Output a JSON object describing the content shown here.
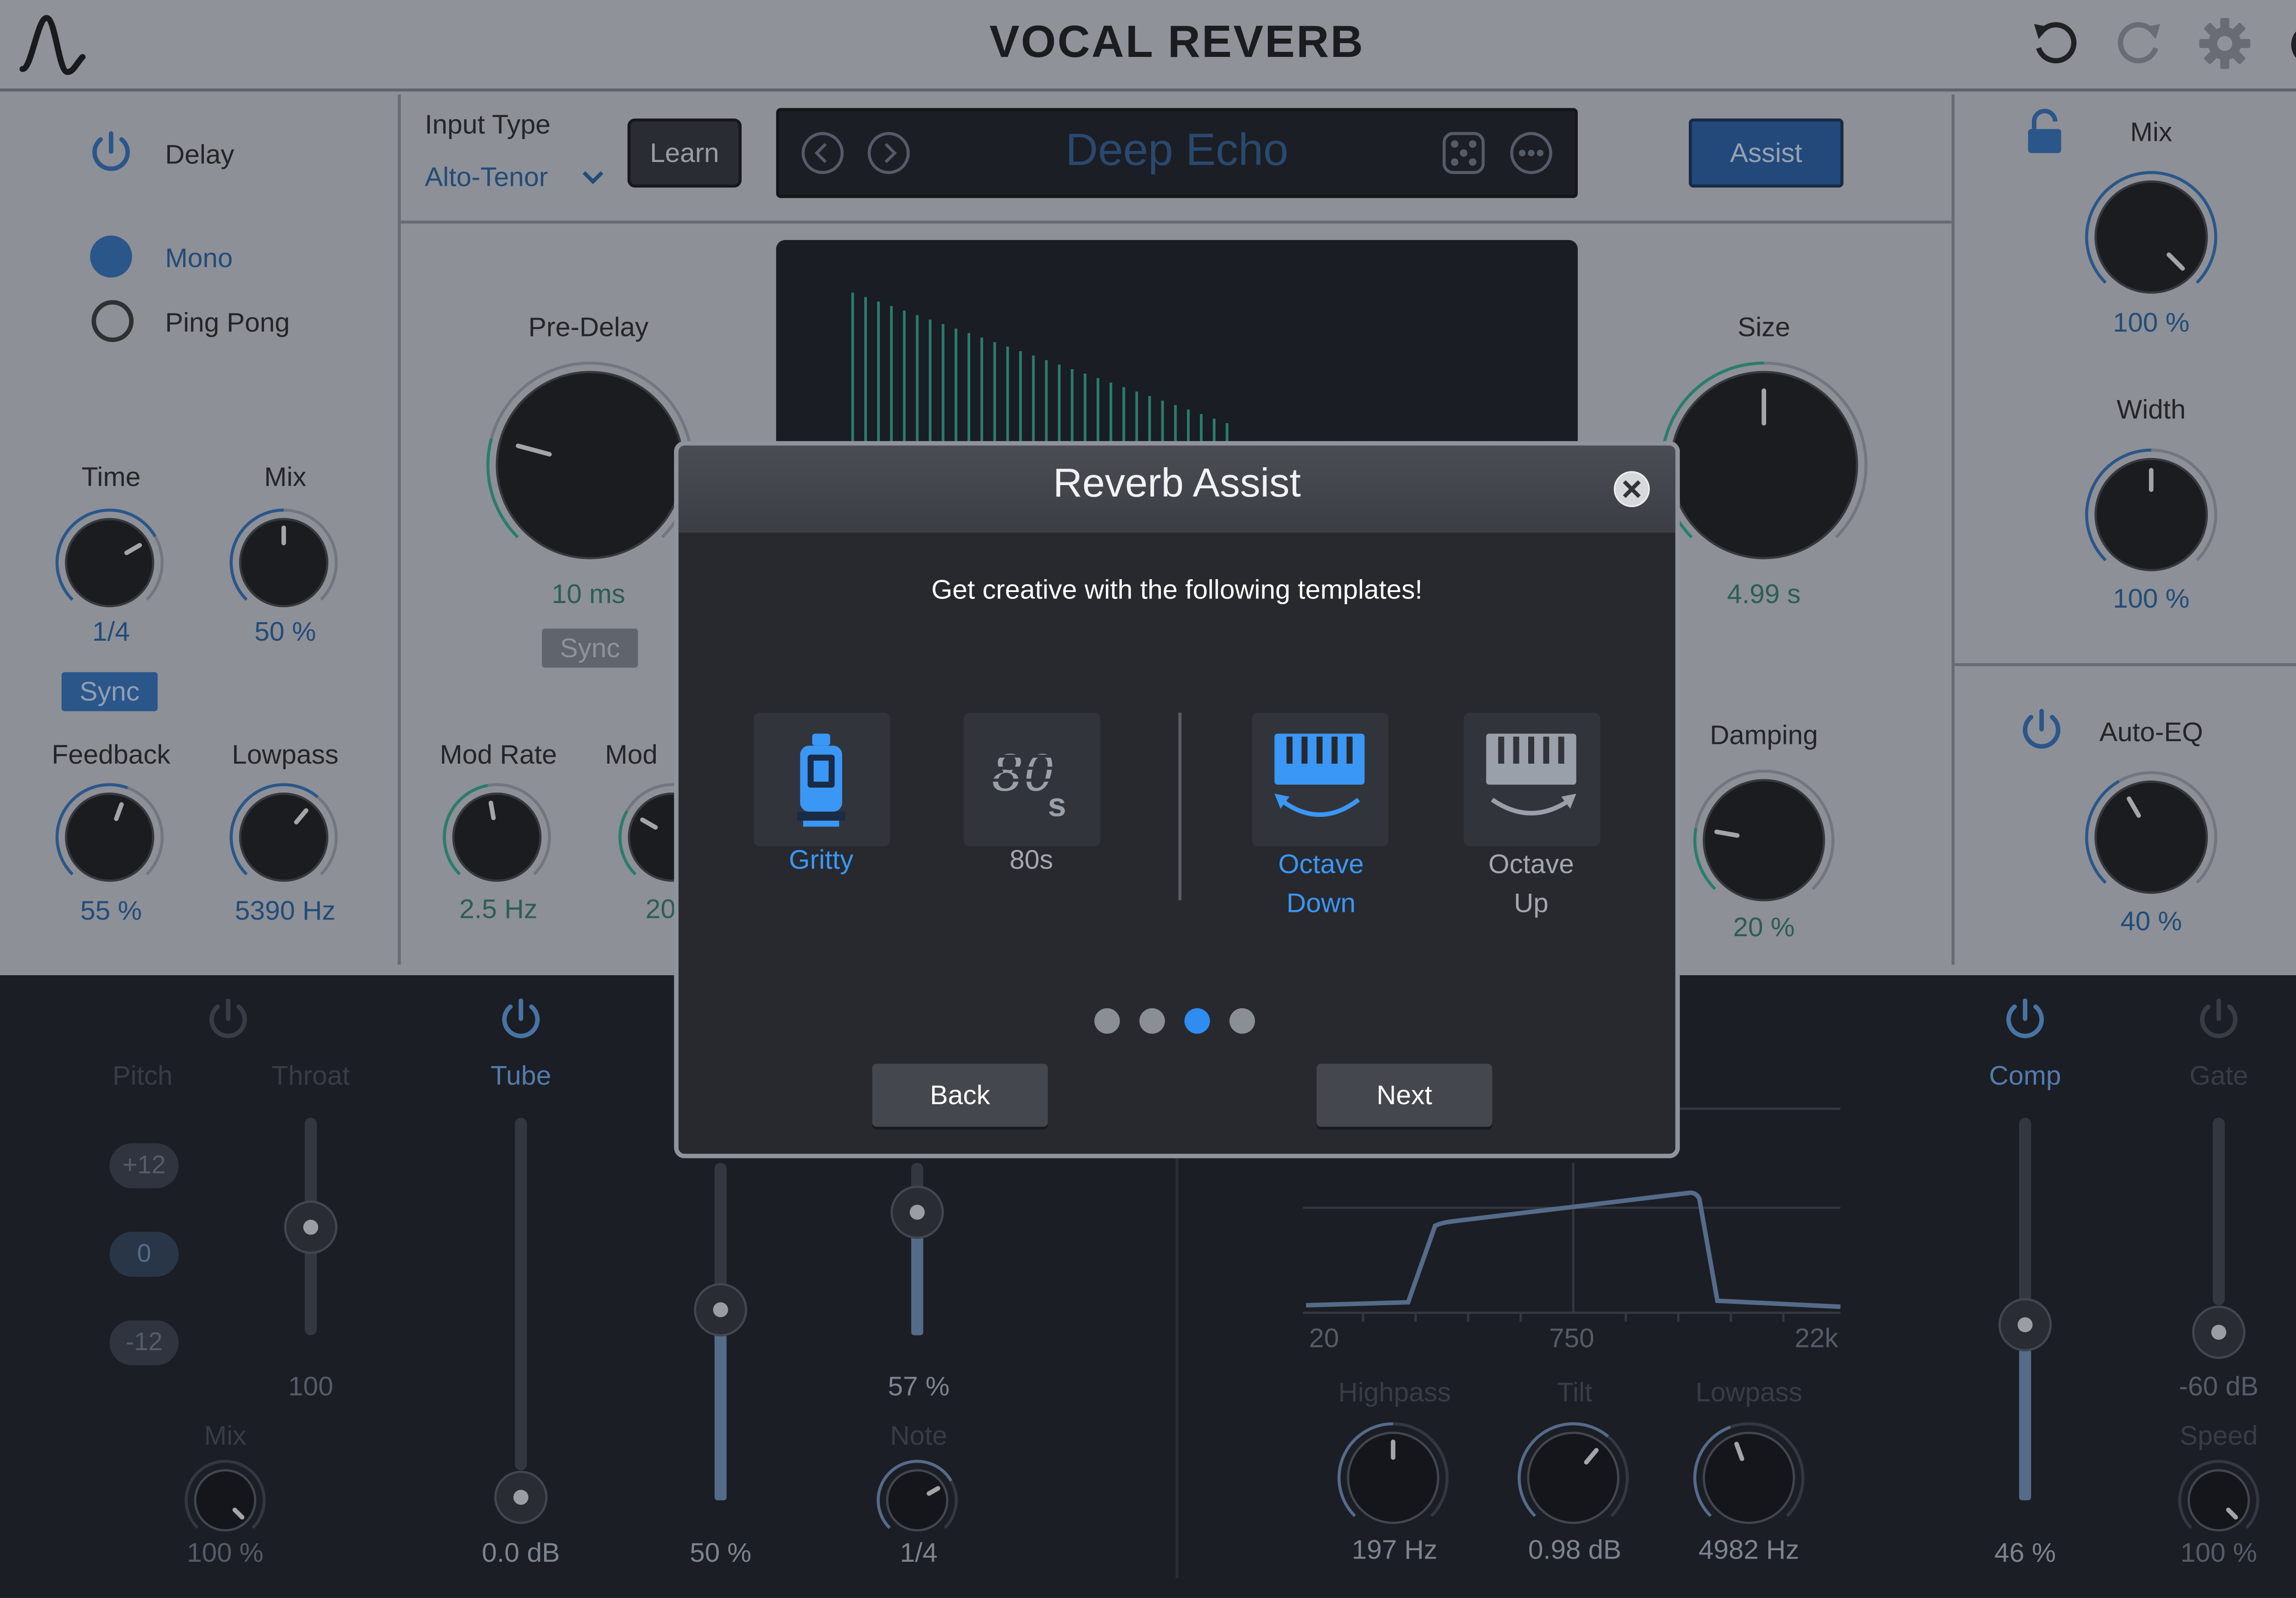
{
  "app": {
    "title": "VOCAL REVERB"
  },
  "delay": {
    "label": "Delay",
    "mode_mono": "Mono",
    "mode_pingpong": "Ping Pong",
    "time_label": "Time",
    "time_value": "1/4",
    "mix_label": "Mix",
    "mix_value": "50 %",
    "sync_label": "Sync",
    "feedback_label": "Feedback",
    "feedback_value": "55 %",
    "lowpass_label": "Lowpass",
    "lowpass_value": "5390 Hz"
  },
  "input": {
    "label": "Input Type",
    "value": "Alto-Tenor",
    "learn_label": "Learn"
  },
  "preset": {
    "name": "Deep Echo",
    "assist_label": "Assist"
  },
  "reverb": {
    "predelay_label": "Pre-Delay",
    "predelay_value": "10 ms",
    "sync_label": "Sync",
    "size_label": "Size",
    "size_value": "4.99 s",
    "modrate_label": "Mod Rate",
    "modrate_value": "2.5 Hz",
    "mod_label": "Mod",
    "mod_value": "20",
    "damping_label": "Damping",
    "damping_value": "20 %"
  },
  "output": {
    "mix_label": "Mix",
    "mix_value": "100 %",
    "width_label": "Width",
    "width_value": "100 %",
    "autoeq_label": "Auto-EQ",
    "autoeq_value": "40 %"
  },
  "strip": {
    "pitch_label": "Pitch",
    "pitch_options": [
      "+12",
      "0",
      "-12"
    ],
    "throat_label": "Throat",
    "throat_value": "100",
    "pitch_mix_label": "Mix",
    "pitch_mix_value": "100 %",
    "tube_label": "Tube",
    "tube_value": "0.0 dB",
    "tube_drive_value": "50 %",
    "note_slider_value": "57 %",
    "note_label": "Note",
    "note_value": "1/4",
    "eq_axis": [
      "20",
      "750",
      "22k"
    ],
    "highpass_label": "Highpass",
    "highpass_value": "197 Hz",
    "tilt_label": "Tilt",
    "tilt_value": "0.98 dB",
    "lowpass_label": "Lowpass",
    "lowpass_value": "4982 Hz",
    "comp_label": "Comp",
    "comp_value": "46 %",
    "gate_label": "Gate",
    "gate_value": "-60 dB",
    "speed_label": "Speed",
    "speed_value": "100 %"
  },
  "modal": {
    "title": "Reverb Assist",
    "subtitle": "Get creative with the following templates!",
    "templates": [
      {
        "label": "Gritty",
        "selected": true,
        "icon": "tube-icon"
      },
      {
        "label": "80s",
        "selected": false,
        "icon": "80s-icon"
      },
      {
        "label": "Octave\nDown",
        "selected": true,
        "icon": "keyboard-down-icon"
      },
      {
        "label": "Octave\nUp",
        "selected": false,
        "icon": "keyboard-up-icon"
      }
    ],
    "page_count": 4,
    "active_page": 3,
    "back_label": "Back",
    "next_label": "Next"
  },
  "colors": {
    "accent": "#2f8cf0",
    "panel": "#c3c6cb",
    "dark": "#15181d",
    "teal": "#2aa98a"
  }
}
